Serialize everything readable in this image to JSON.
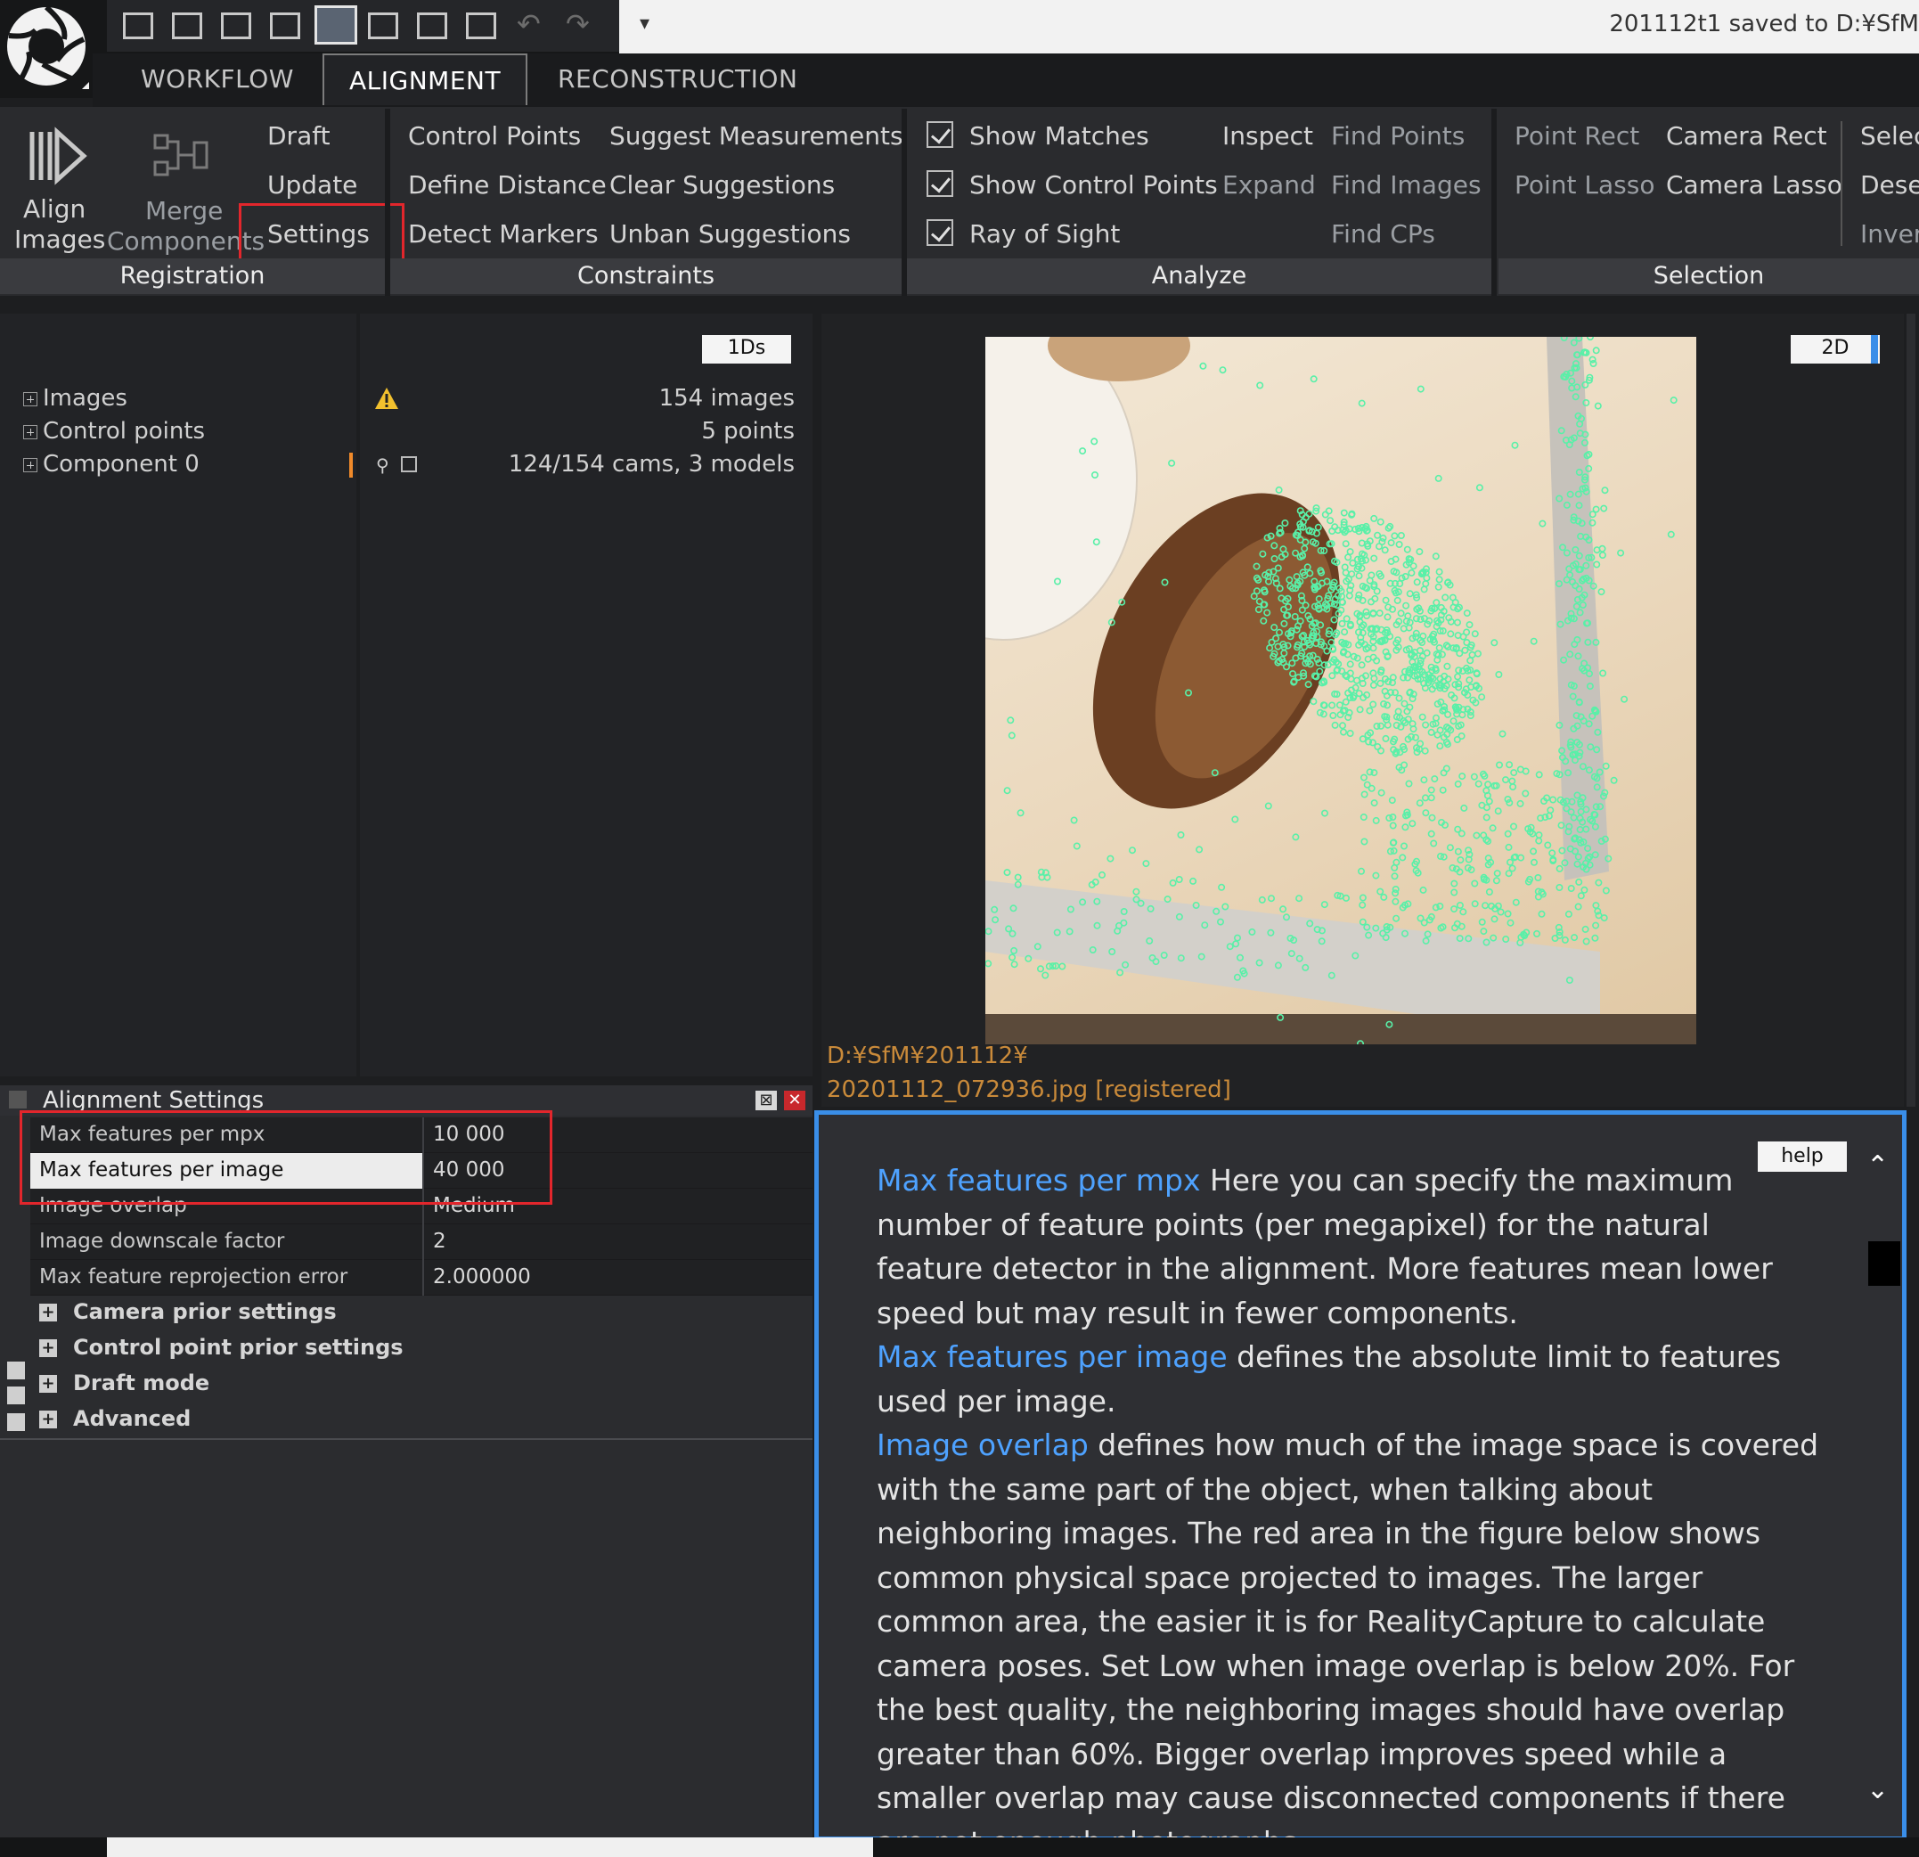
{
  "window": {
    "save_status": "201112t1 saved to D:¥SfM"
  },
  "tabs": [
    {
      "label": "WORKFLOW"
    },
    {
      "label": "ALIGNMENT"
    },
    {
      "label": "RECONSTRUCTION"
    }
  ],
  "ribbon": {
    "registration": {
      "label": "Registration",
      "align_images": [
        "Align",
        "Images"
      ],
      "merge_components": [
        "Merge",
        "Components"
      ],
      "draft": "Draft",
      "update": "Update",
      "settings": "Settings"
    },
    "constraints": {
      "label": "Constraints",
      "control_points": "Control Points",
      "suggest_measurements": "Suggest Measurements",
      "define_distance": "Define Distance",
      "clear_suggestions": "Clear Suggestions",
      "detect_markers": "Detect Markers",
      "unban_suggestions": "Unban Suggestions"
    },
    "analyze": {
      "label": "Analyze",
      "show_matches": "Show Matches",
      "show_control_points": "Show Control Points",
      "ray_of_sight": "Ray of Sight",
      "inspect": "Inspect",
      "expand": "Expand",
      "find_points": "Find Points",
      "find_images": "Find Images",
      "find_cps": "Find CPs"
    },
    "selection": {
      "label": "Selection",
      "point_rect": "Point Rect",
      "point_lasso": "Point Lasso",
      "camera_rect": "Camera Rect",
      "camera_lasso": "Camera Lasso",
      "select": "Selec",
      "deselect": "Desel",
      "invert": "Inver"
    }
  },
  "tree": [
    {
      "label": "Images",
      "value": "154 images"
    },
    {
      "label": "Control points",
      "value": "5 points"
    },
    {
      "label": "Component 0",
      "value": "124/154 cams, 3 models"
    }
  ],
  "info_chip": "1Ds",
  "viewer": {
    "mode_chip": "2D",
    "path_line1": "D:¥SfM¥201112¥",
    "path_line2": "20201112_072936.jpg [registered]"
  },
  "settings": {
    "title": "Alignment Settings",
    "rows": [
      {
        "name": "Max features per mpx",
        "value": "10 000"
      },
      {
        "name": "Max features per image",
        "value": "40 000"
      },
      {
        "name": "Image overlap",
        "value": "Medium"
      },
      {
        "name": "Image downscale factor",
        "value": "2"
      },
      {
        "name": "Max feature reprojection error",
        "value": "2.000000"
      }
    ],
    "categories": [
      "Camera prior settings",
      "Control point prior settings",
      "Draft mode",
      "Advanced"
    ]
  },
  "help": {
    "chip": "help",
    "p1_term": "Max features per mpx",
    "p1_text": " Here you can specify the maximum number of feature points (per megapixel) for the natural feature detector in the alignment. More features mean lower speed but may result in fewer components.",
    "p2_term": "Max features per image",
    "p2_text": " defines the absolute limit to features used per image.",
    "p3_term": "Image overlap",
    "p3_text": " defines how much of the image space is covered with the same part of the object, when talking about neighboring images. The red area in the figure below shows common physical space projected to images. The larger common area, the easier it is for RealityCapture to calculate camera poses. Set Low when image overlap is below 20%. For the best quality, the neighboring images should have overlap greater than 60%. Bigger overlap improves speed while a smaller overlap may cause disconnected components if there are not enough photographs."
  },
  "colors": {
    "highlight_red": "#e2262c",
    "help_border": "#3a8ee8",
    "term_blue": "#4ea2ff",
    "path_orange": "#c98a3a",
    "feature_green": "#59f0a8"
  }
}
